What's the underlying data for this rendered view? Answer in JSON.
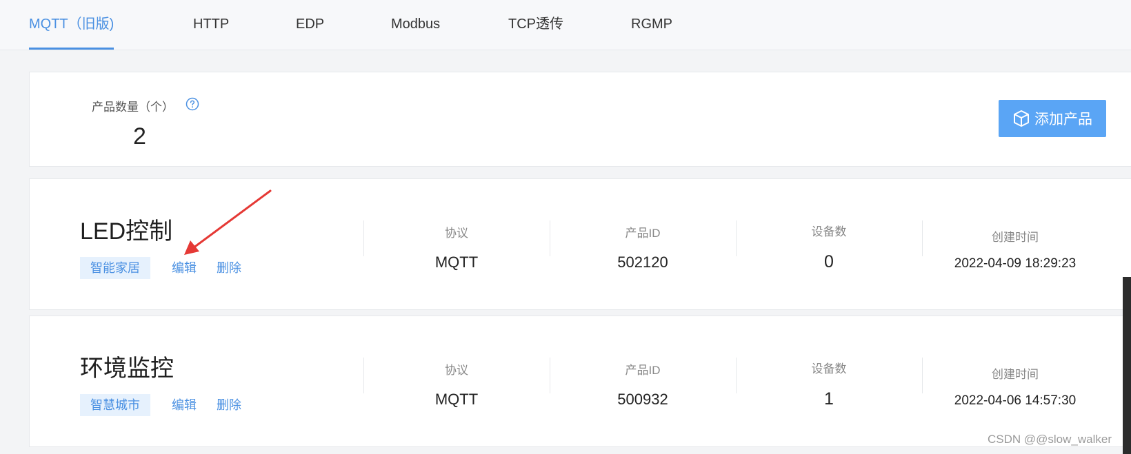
{
  "tabs": [
    {
      "label": "MQTT（旧版)",
      "active": true
    },
    {
      "label": "HTTP",
      "active": false
    },
    {
      "label": "EDP",
      "active": false
    },
    {
      "label": "Modbus",
      "active": false
    },
    {
      "label": "TCP透传",
      "active": false
    },
    {
      "label": "RGMP",
      "active": false
    }
  ],
  "summary": {
    "label": "产品数量（个）",
    "help_icon": "question-circle-icon",
    "count": "2",
    "add_button_icon": "cube-icon",
    "add_button_label": "添加产品"
  },
  "products": [
    {
      "name": "LED控制",
      "tag": "智能家居",
      "edit_label": "编辑",
      "delete_label": "删除",
      "protocol_label": "协议",
      "protocol": "MQTT",
      "id_label": "产品ID",
      "id": "502120",
      "device_count_label": "设备数",
      "device_count": "0",
      "created_label": "创建时间",
      "created": "2022-04-09 18:29:23"
    },
    {
      "name": "环境监控",
      "tag": "智慧城市",
      "edit_label": "编辑",
      "delete_label": "删除",
      "protocol_label": "协议",
      "protocol": "MQTT",
      "id_label": "产品ID",
      "id": "500932",
      "device_count_label": "设备数",
      "device_count": "1",
      "created_label": "创建时间",
      "created": "2022-04-06 14:57:30"
    }
  ],
  "colors": {
    "accent": "#4a90e2",
    "button": "#5aa5f5",
    "annotation_arrow": "#e53935"
  },
  "watermark": "CSDN @@slow_walker"
}
